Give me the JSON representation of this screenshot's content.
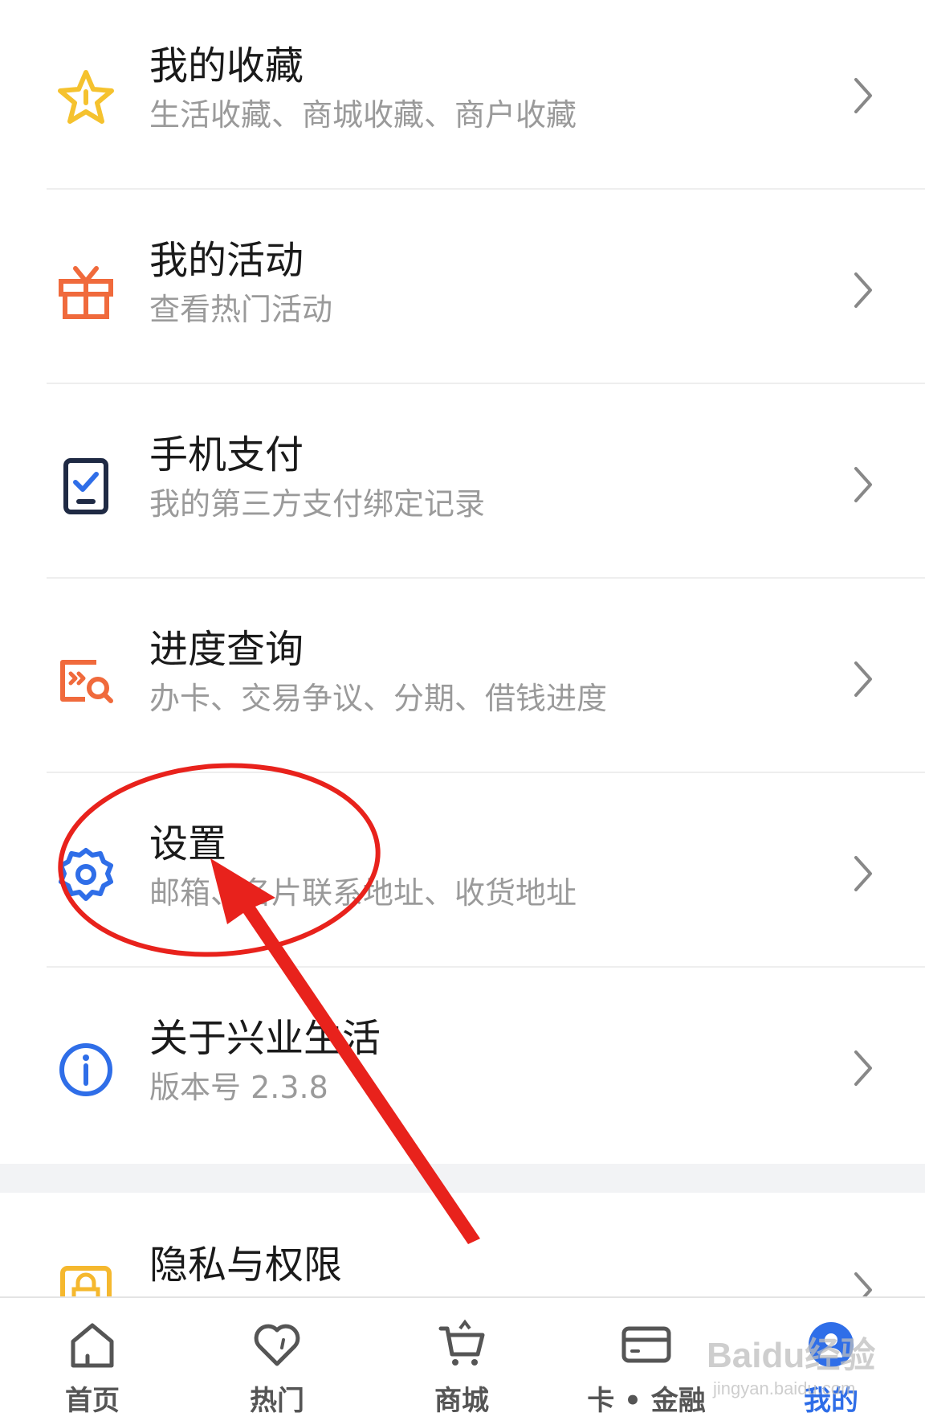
{
  "menu": {
    "favorites": {
      "title": "我的收藏",
      "subtitle": "生活收藏、商城收藏、商户收藏"
    },
    "activities": {
      "title": "我的活动",
      "subtitle": "查看热门活动"
    },
    "mobile_pay": {
      "title": "手机支付",
      "subtitle": "我的第三方支付绑定记录"
    },
    "progress": {
      "title": "进度查询",
      "subtitle": "办卡、交易争议、分期、借钱进度"
    },
    "settings": {
      "title": "设置",
      "subtitle": "邮箱、名片联系地址、收货地址"
    },
    "about": {
      "title": "关于兴业生活",
      "subtitle": "版本号 2.3.8"
    },
    "privacy": {
      "title": "隐私与权限"
    }
  },
  "tabbar": {
    "home": "首页",
    "hot": "热门",
    "mall": "商城",
    "card_finance": "卡 • 金融",
    "mine": "我的"
  },
  "watermark": {
    "brand": "Baidu经验",
    "url": "jingyan.baidu.com"
  },
  "colors": {
    "star": "#f5c22e",
    "gift": "#f06a3c",
    "phone": "#1f2a44",
    "progress": "#f06a3c",
    "settings": "#2f6ee8",
    "info": "#2f6ee8",
    "privacy": "#f5b82e",
    "annotation": "#e8221c",
    "active_tab": "#2f6ee8"
  },
  "icons": {
    "favorites": "star-icon",
    "activities": "gift-icon",
    "mobile_pay": "phone-check-icon",
    "progress": "search-progress-icon",
    "settings": "gear-icon",
    "about": "info-icon",
    "privacy": "lock-icon"
  }
}
